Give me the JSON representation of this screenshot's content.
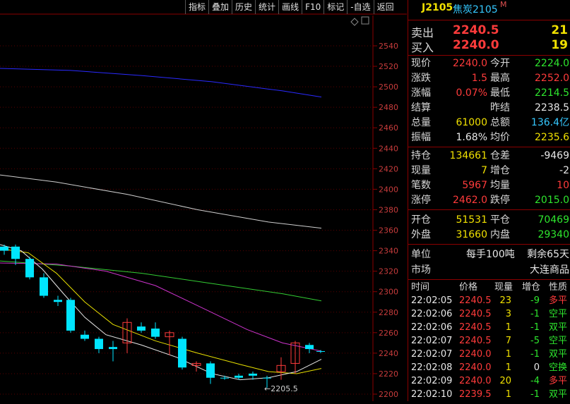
{
  "toolbar": [
    "指标",
    "叠加",
    "历史",
    "统计",
    "画线",
    "F10",
    "标记",
    "-自选",
    "返回"
  ],
  "chart": {
    "y_ticks": [
      "2540",
      "2520",
      "2500",
      "2480",
      "2460",
      "2440",
      "2420",
      "2400",
      "2380",
      "2360",
      "2340",
      "2320",
      "2300",
      "2280",
      "2260",
      "2240",
      "2220",
      "2200"
    ],
    "low_annotation": "←2205.5",
    "up_color": "#ff3b3b",
    "down_color": "#00e5ff"
  },
  "header": {
    "code": "J2105",
    "name": "焦炭2105",
    "mark": "M"
  },
  "quote": {
    "sell_label": "卖出",
    "sell_price": "2240.5",
    "sell_vol": "21",
    "buy_label": "买入",
    "buy_price": "2240.0",
    "buy_vol": "19"
  },
  "stats1": [
    {
      "l1": "现价",
      "v1": "2240.0",
      "l2": "今开",
      "v2": "2224.0"
    },
    {
      "l1": "涨跌",
      "v1": "1.5",
      "l2": "最高",
      "v2": "2252.0"
    },
    {
      "l1": "涨幅",
      "v1": "0.07%",
      "l2": "最低",
      "v2": "2214.5"
    },
    {
      "l1": "结算",
      "v1": "",
      "l2": "昨结",
      "v2": "2238.5"
    },
    {
      "l1": "总量",
      "v1": "61000",
      "l2": "总额",
      "v2": "136.4亿"
    },
    {
      "l1": "振幅",
      "v1": "1.68%",
      "l2": "均价",
      "v2": "2235.6"
    }
  ],
  "stats2": [
    {
      "l1": "持仓",
      "v1": "134661",
      "l2": "仓差",
      "v2": "-9469"
    },
    {
      "l1": "现量",
      "v1": "7",
      "l2": "增仓",
      "v2": "-2"
    },
    {
      "l1": "笔数",
      "v1": "5967",
      "l2": "均量",
      "v2": "10"
    },
    {
      "l1": "涨停",
      "v1": "2462.0",
      "l2": "跌停",
      "v2": "2015.0"
    }
  ],
  "stats3": [
    {
      "l1": "开仓",
      "v1": "51531",
      "l2": "平仓",
      "v2": "70469"
    },
    {
      "l1": "外盘",
      "v1": "31660",
      "l2": "内盘",
      "v2": "29340"
    }
  ],
  "info": {
    "unit_label": "单位",
    "unit_value": "每手100吨",
    "remain": "剩余65天",
    "market_label": "市场",
    "market_value": "大连商品"
  },
  "ticks_header": {
    "time": "时间",
    "price": "价格",
    "vol": "现量",
    "oi": "增仓",
    "nature": "性质"
  },
  "ticks": [
    {
      "time": "22:02:05",
      "price": "2240.5",
      "vol": "23",
      "oi": "-9",
      "nature": "多平"
    },
    {
      "time": "22:02:06",
      "price": "2240.5",
      "vol": "3",
      "oi": "-1",
      "nature": "空平"
    },
    {
      "time": "22:02:06",
      "price": "2240.5",
      "vol": "1",
      "oi": "-1",
      "nature": "双平"
    },
    {
      "time": "22:02:07",
      "price": "2240.5",
      "vol": "7",
      "oi": "-5",
      "nature": "空平"
    },
    {
      "time": "22:02:07",
      "price": "2240.0",
      "vol": "1",
      "oi": "-1",
      "nature": "双平"
    },
    {
      "time": "22:02:08",
      "price": "2240.0",
      "vol": "1",
      "oi": "0",
      "nature": "空换"
    },
    {
      "time": "22:02:09",
      "price": "2240.0",
      "vol": "20",
      "oi": "-4",
      "nature": "多平"
    },
    {
      "time": "22:02:10",
      "price": "2239.5",
      "vol": "1",
      "oi": "-1",
      "nature": "双平"
    }
  ]
}
